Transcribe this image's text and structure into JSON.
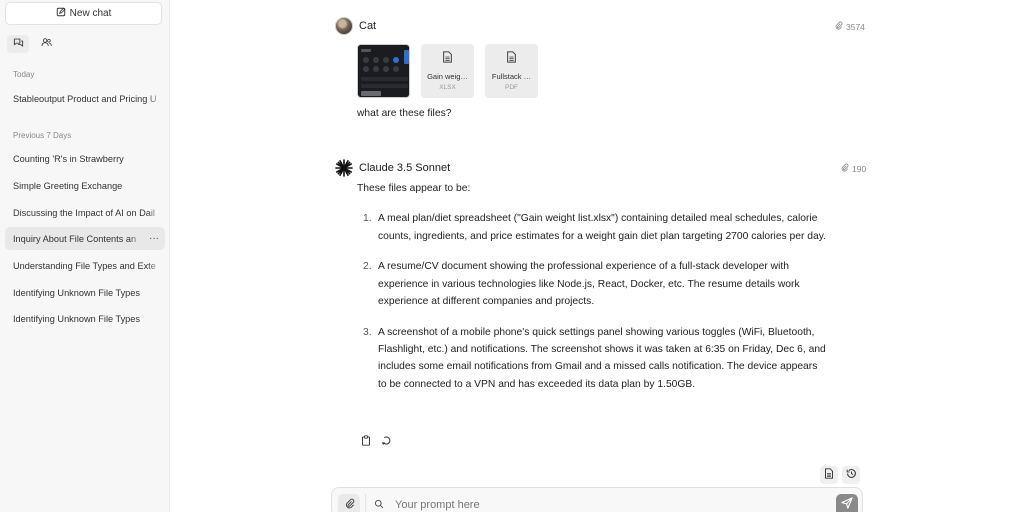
{
  "sidebar": {
    "new_chat_label": "New chat",
    "tabs": [
      {
        "icon": "chats-icon",
        "active": true
      },
      {
        "icon": "users-icon",
        "active": false
      }
    ],
    "sections": {
      "today": "Today",
      "previous_7_days": "Previous 7 Days"
    },
    "today_items": [
      {
        "label": "Stableoutput Product and Pricing U"
      }
    ],
    "previous_items": [
      {
        "label": "Counting 'R's in Strawberry"
      },
      {
        "label": "Simple Greeting Exchange"
      },
      {
        "label": "Discussing the Impact of AI on Dail"
      },
      {
        "label": "Inquiry About File Contents an",
        "active": true,
        "more": "···"
      },
      {
        "label": "Understanding File Types and Exte"
      },
      {
        "label": "Identifying Unknown File Types"
      },
      {
        "label": "Identifying Unknown File Types"
      }
    ]
  },
  "messages": {
    "user": {
      "name": "Cat",
      "tokens": "3574",
      "attachments": [
        {
          "type": "image",
          "icon": "image-thumbnail"
        },
        {
          "type": "file",
          "name": "Gain weig…",
          "ext": "XLSX",
          "icon": "document-icon"
        },
        {
          "type": "file",
          "name": "Fullstack …",
          "ext": "PDF",
          "icon": "document-icon"
        }
      ],
      "text": "what are these files?"
    },
    "assistant": {
      "name": "Claude 3.5 Sonnet",
      "tokens": "190",
      "intro": "These files appear to be:",
      "items": [
        {
          "num": "1.",
          "text": "A meal plan/diet spreadsheet (\"Gain weight list.xlsx\") containing detailed meal schedules, calorie counts, ingredients, and price estimates for a weight gain diet plan targeting 2700 calories per day."
        },
        {
          "num": "2.",
          "text": "A resume/CV document showing the professional experience of a full-stack developer with experience in various technologies like Node.js, React, Docker, etc. The resume details work experience at different companies and projects."
        },
        {
          "num": "3.",
          "text": "A screenshot of a mobile phone's quick settings panel showing various toggles (WiFi, Bluetooth, Flashlight, etc.) and notifications. The screenshot shows it was taken at 6:35 on Friday, Dec 6, and includes some email notifications from Gmail and a missed calls notification. The device appears to be connected to a VPN and has exceeded its data plan by 1.50GB."
        }
      ]
    }
  },
  "composer": {
    "placeholder": "Your prompt here"
  },
  "colors": {
    "sidebar_bg": "#f7f7f7",
    "active_item": "#e8e8e8",
    "send_button": "#8a8a8a"
  }
}
